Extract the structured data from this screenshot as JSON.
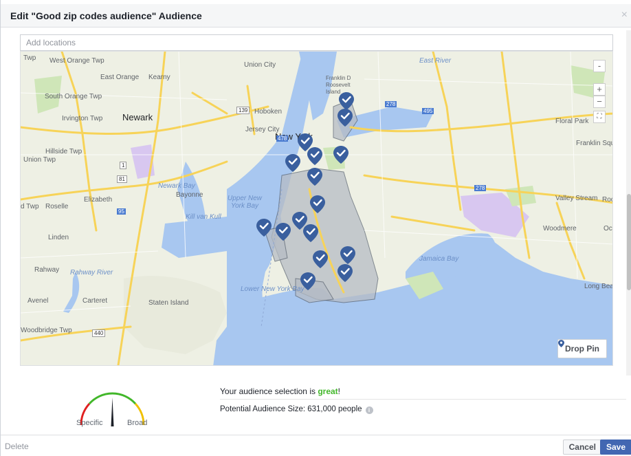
{
  "dialog": {
    "title": "Edit \"Good zip codes audience\" Audience",
    "close_symbol": "×"
  },
  "search": {
    "placeholder": "Add locations",
    "value": ""
  },
  "map": {
    "place_labels": [
      "West Orange Twp",
      "East Orange",
      "Kearny",
      "Union City",
      "South Orange Twp",
      "Irvington Twp",
      "Newark",
      "Hoboken",
      "Jersey City",
      "New York",
      "Union Twp",
      "Hillside",
      "Hillside Twp",
      "Elizabeth",
      "Roselle",
      "Bayonne",
      "Linden",
      "Rahway",
      "Avenel",
      "Carteret",
      "Woodbridge Twp",
      "Floral Park",
      "Franklin Square",
      "Valley Stream",
      "Woodmere",
      "Long Beach",
      "Jamaica Bay",
      "Newark Bay",
      "Upper New York Bay",
      "Lower New York Bay",
      "Staten Island",
      "Kill van Kull",
      "Rahway River",
      "Franklin D Roosevelt Island",
      "East River",
      "Twp",
      "d Twp",
      "Roo",
      "Oc"
    ],
    "route_shields": [
      "139",
      "478",
      "1",
      "81",
      "95",
      "440",
      "278",
      "495",
      "278"
    ],
    "controls": {
      "zoom_in": "+",
      "zoom_out": "−",
      "fullscreen": "⛶",
      "collapse": "-"
    },
    "drop_pin_label": "Drop Pin",
    "selected_pin_count": 16
  },
  "audience": {
    "gauge": {
      "left_label": "Specific",
      "right_label": "Broad",
      "level": 0.5
    },
    "summary_prefix": "Your audience selection is ",
    "summary_status": "great",
    "summary_suffix": "!",
    "size_text": "Potential Audience Size: 631,000 people",
    "info_icon": "i"
  },
  "footer": {
    "delete_label": "Delete",
    "cancel_label": "Cancel",
    "save_label": "Save"
  },
  "colors": {
    "brand_blue": "#4267b2",
    "pin_blue": "#3a5f9e",
    "great_green": "#42b72a",
    "water": "#a8c7f0",
    "land": "#eef0e4",
    "park": "#cfe6b8",
    "highway": "#f7d358"
  }
}
